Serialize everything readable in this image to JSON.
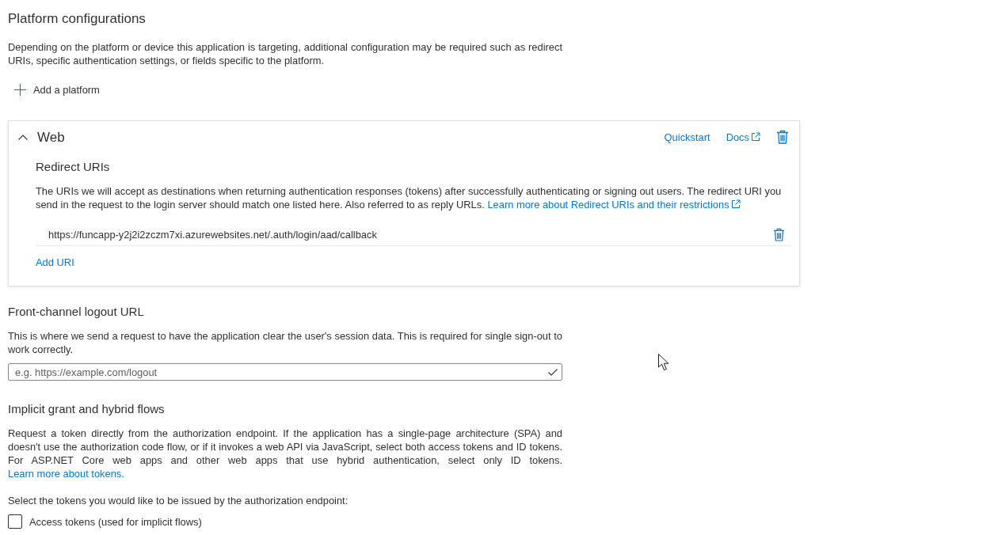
{
  "platform_configurations": {
    "title": "Platform configurations",
    "description": "Depending on the platform or device this application is targeting, additional configuration may be required such as redirect URIs, specific authentication settings, or fields specific to the platform.",
    "add_platform": "Add a platform"
  },
  "platforms": [
    {
      "name": "Web",
      "expanded": true,
      "links": [
        {
          "label": "Quickstart",
          "external": false
        },
        {
          "label": "Docs",
          "external": true
        }
      ],
      "redirect_uris": {
        "title": "Redirect URIs",
        "description": "The URIs we will accept as destinations when returning authentication responses (tokens) after successfully authenticating or signing out users. The redirect URI you send in the request to the login server should match one listed here. Also referred to as reply URLs.",
        "learn_more": "Learn more about Redirect URIs and their restrictions",
        "uris": [
          "https://funcapp-y2j2i2zczm7xi.azurewebsites.net/.auth/login/aad/callback"
        ],
        "add_uri": "Add URI"
      }
    }
  ],
  "front_channel_logout": {
    "title": "Front-channel logout URL",
    "description": "This is where we send a request to have the application clear the user's session data. This is required for single sign-out to work correctly.",
    "url_field": {
      "placeholder": "e.g. https://example.com/logout",
      "valid": true
    }
  },
  "implicit_grant": {
    "title": "Implicit grant and hybrid flows",
    "description": "Request a token directly from the authorization endpoint. If the application has a single-page architecture (SPA) and doesn't use the authorization code flow, or if it invokes a web API via JavaScript, select both access tokens and ID tokens. For ASP.NET Core web apps and other web apps that use hybrid authentication, select only ID tokens.",
    "learn_more": "Learn more about tokens.",
    "tokens_prompt": "Select the tokens you would like to be issued by the authorization endpoint:",
    "tokens": [
      {
        "label": "Access tokens (used for implicit flows)",
        "checked": false
      }
    ]
  }
}
